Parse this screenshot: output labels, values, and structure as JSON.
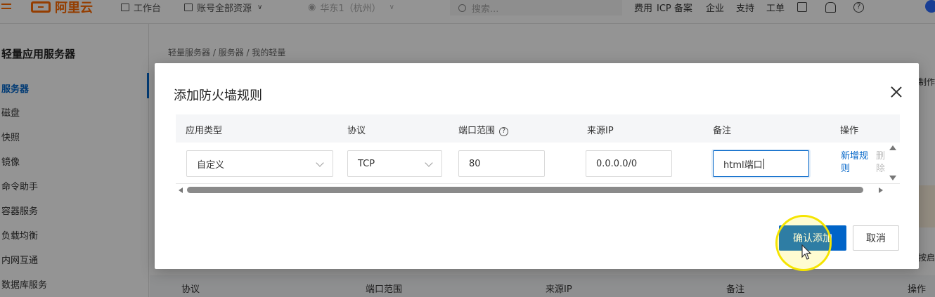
{
  "topbar": {
    "logo": "阿里云",
    "workbench": "工作台",
    "account_resources": "账号全部资源",
    "region": "华东1（杭州）",
    "search_placeholder": "搜索...",
    "links": [
      "费用",
      "ICP 备案",
      "企业",
      "支持",
      "工单"
    ]
  },
  "sidebar": {
    "title": "轻量应用服务器",
    "items": [
      "服务器",
      "磁盘",
      "快照",
      "镜像",
      "命令助手",
      "容器服务",
      "负载均衡",
      "内网互通",
      "数据库服务"
    ],
    "active_index": 0
  },
  "main": {
    "breadcrumb": "轻量服务器 / 服务器 / 我的轻量",
    "peek_right_top": "制作",
    "peek_right_mid": "按启",
    "table_headers": [
      "协议",
      "端口范围",
      "来源IP",
      "备注",
      "操作"
    ]
  },
  "modal": {
    "title": "添加防火墙规则",
    "headers": {
      "app_type": "应用类型",
      "protocol": "协议",
      "port_range": "端口范围",
      "source_ip": "来源IP",
      "remark": "备注",
      "action": "操作"
    },
    "row": {
      "app_type": "自定义",
      "protocol": "TCP",
      "port_range": "80",
      "source_ip": "0.0.0.0/0",
      "remark": "html端口"
    },
    "add_rule_label": "新增规则",
    "delete_label": "删除",
    "confirm_label": "确认添加",
    "cancel_label": "取消"
  },
  "colors": {
    "accent": "#0064c8",
    "brand": "#ff6a00",
    "highlight": "#f5e400"
  },
  "icons": [
    "menu-icon",
    "home-icon",
    "list-icon",
    "location-icon",
    "search-icon",
    "terminal-icon",
    "bell-icon",
    "help-icon",
    "close-icon",
    "chevron-down-icon"
  ]
}
